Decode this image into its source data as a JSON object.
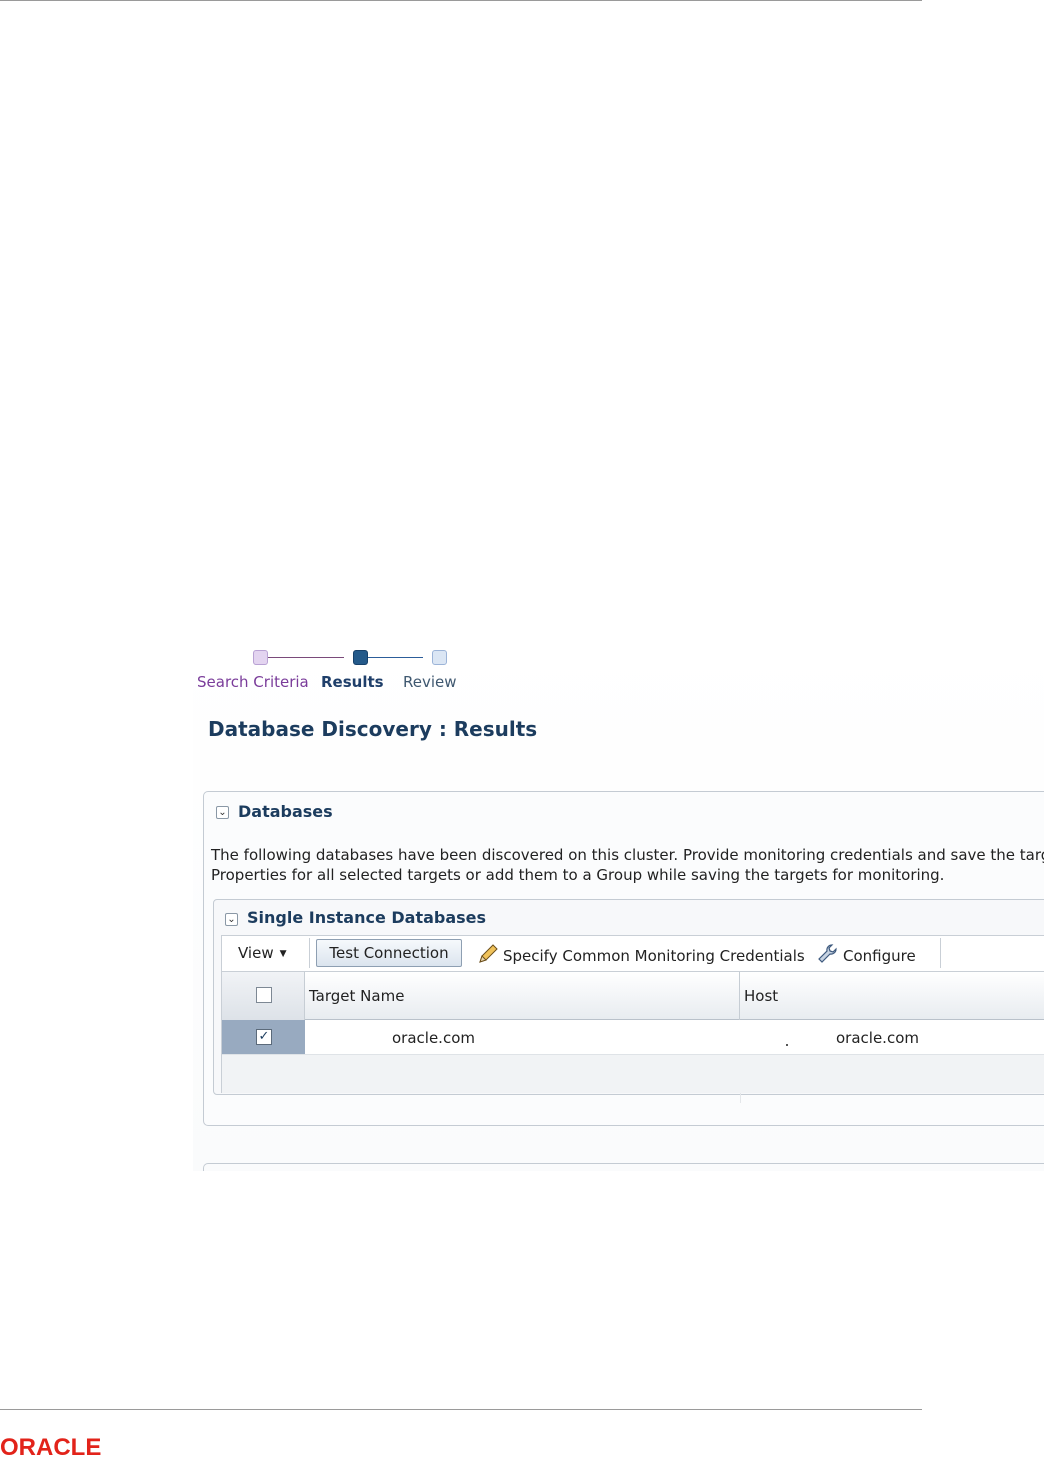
{
  "train": {
    "stops": [
      {
        "label": "Search Criteria",
        "state": "visited"
      },
      {
        "label": "Results",
        "state": "current"
      },
      {
        "label": "Review",
        "state": "next"
      }
    ]
  },
  "page": {
    "title": "Database Discovery : Results"
  },
  "databases_panel": {
    "header": "Databases",
    "description_line1": "The following databases have been discovered on this cluster. Provide monitoring credentials and save the targets f",
    "description_line2": "Properties for all selected targets or add them to a Group while saving the targets for monitoring.",
    "single_instance": {
      "header": "Single Instance Databases",
      "toolbar": {
        "view_label": "View",
        "test_connection_label": "Test Connection",
        "specify_credentials_label": "Specify Common Monitoring Credentials",
        "configure_label": "Configure"
      },
      "table": {
        "columns": [
          "Target Name",
          "Host"
        ],
        "rows": [
          {
            "selected": true,
            "target_name": "oracle.com",
            "host": "oracle.com"
          }
        ]
      }
    }
  },
  "footer": {
    "logo_text": "ORACLE"
  },
  "colors": {
    "brand_red": "#e2231a",
    "header_blue": "#1c3c5e",
    "train_visited": "#7a3c9a",
    "selection": "#98aac0"
  }
}
